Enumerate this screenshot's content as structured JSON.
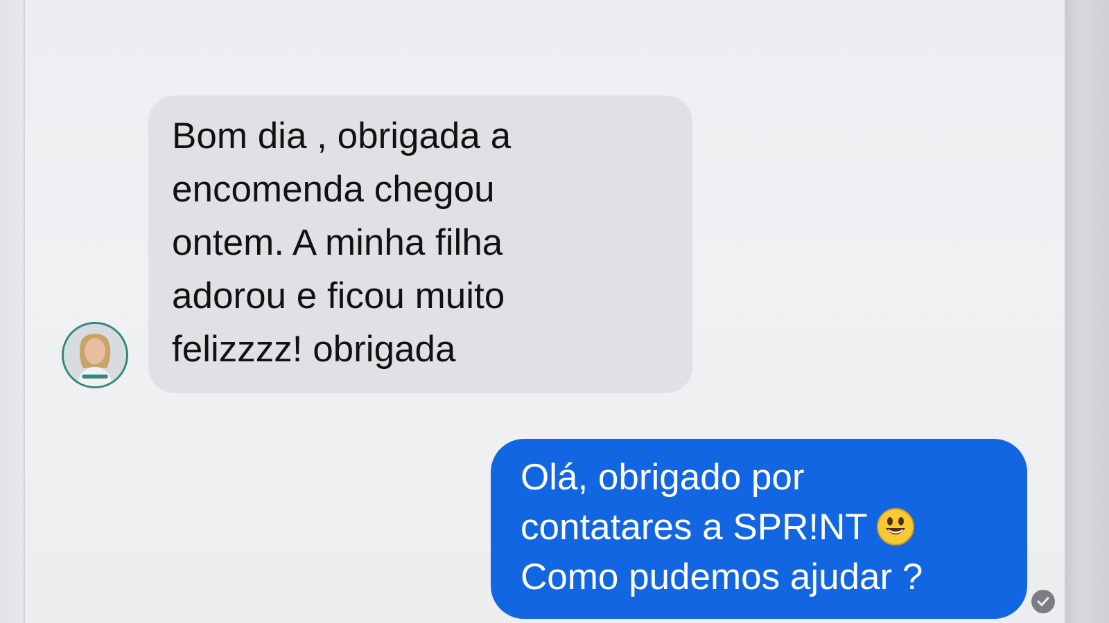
{
  "incoming_message": {
    "text": "Bom dia , obrigada a\nencomenda chegou\nontem. A minha filha\nadorou e ficou muito\nfelizzzz! obrigada"
  },
  "outgoing_message": {
    "line1": "Olá, obrigado por",
    "line2": "contatares a SPR!NT",
    "line3": "Como pudemos ajudar ?",
    "emoji": "grinning-face-emoji"
  },
  "status": {
    "icon": "check-circle-icon"
  },
  "colors": {
    "incoming_bubble": "#e0e1e4",
    "outgoing_bubble": "#1366e2",
    "avatar_ring": "#2f8a7c"
  }
}
